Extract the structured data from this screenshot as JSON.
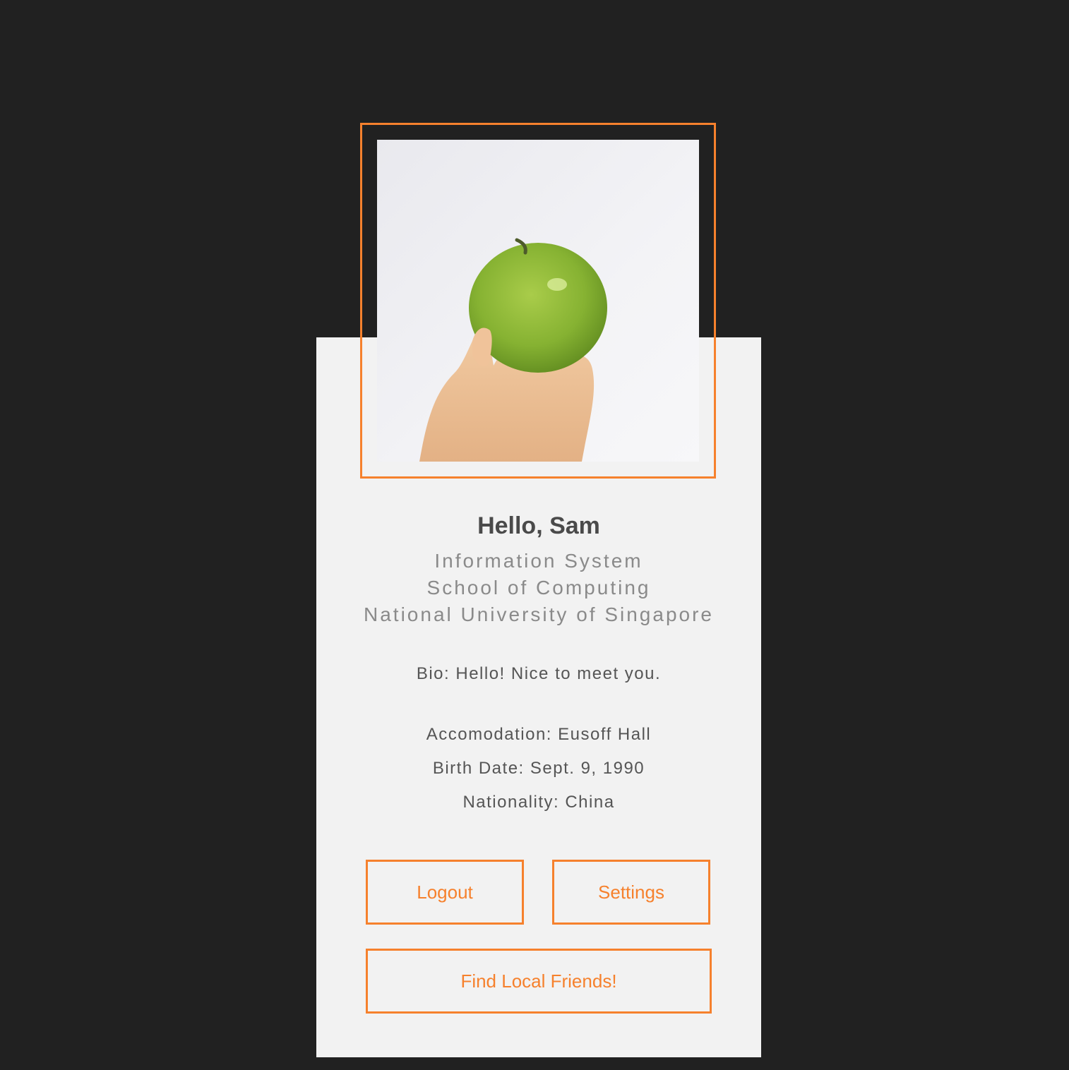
{
  "profile": {
    "greeting": "Hello, Sam",
    "major": "Information System",
    "school": "School of Computing",
    "university": "National University of Singapore",
    "bio": "Bio: Hello! Nice to meet you.",
    "accommodation": "Accomodation: Eusoff Hall",
    "birth_date": "Birth Date: Sept. 9, 1990",
    "nationality": "Nationality: China",
    "photo": "green-apple-in-hand-photo"
  },
  "actions": {
    "logout_label": "Logout",
    "settings_label": "Settings",
    "find_friends_label": "Find Local Friends!"
  },
  "colors": {
    "background": "#212121",
    "card": "#f2f2f2",
    "accent": "#f6812d",
    "heading": "#4a4a4a",
    "subtext": "#8a8a8a",
    "body_text": "#555555"
  }
}
